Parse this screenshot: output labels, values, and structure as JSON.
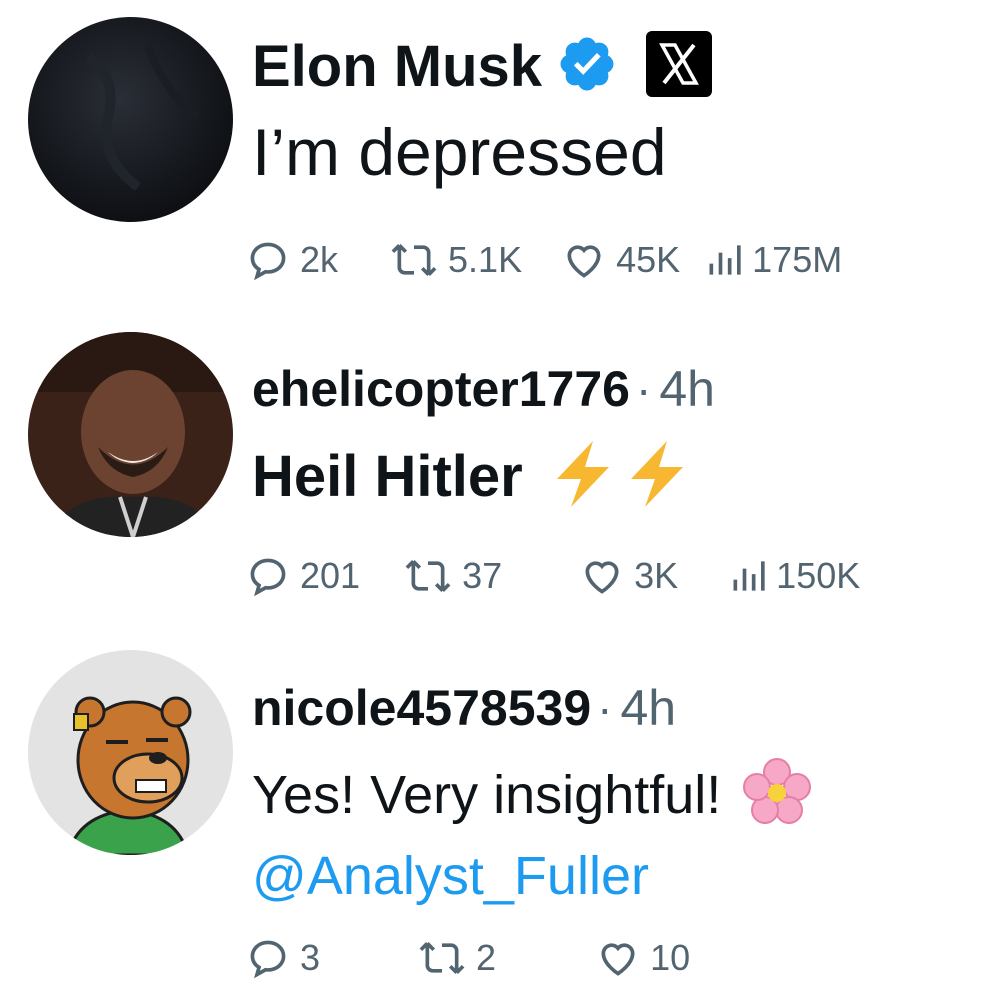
{
  "posts": [
    {
      "name": "Elon Musk",
      "verified": true,
      "affiliate_badge": "x-logo",
      "text": "I’m depressed",
      "metrics": {
        "replies": "2k",
        "reposts": "5.1K",
        "likes": "45K",
        "views": "175M"
      }
    },
    {
      "name": "ehelicopter1776",
      "time": "4h",
      "separator": "·",
      "text": "Heil Hitler",
      "emoji": "⚡⚡",
      "metrics": {
        "replies": "201",
        "reposts": "37",
        "likes": "3K",
        "views": "150K"
      }
    },
    {
      "name": "nicole4578539",
      "time": "4h",
      "separator": "·",
      "text": "Yes! Very insightful!",
      "emoji": "🌸",
      "mention": "@Analyst_Fuller",
      "metrics": {
        "replies": "3",
        "reposts": "2",
        "likes": "10"
      }
    }
  ],
  "colors": {
    "text": "#0f1419",
    "secondary": "#536471",
    "link": "#1d9bf0",
    "verified": "#1d9bf0",
    "lightning": "#f7b731",
    "flower": "#f7a8c6"
  },
  "icons": [
    "reply-icon",
    "repost-icon",
    "like-icon",
    "views-icon",
    "verified-badge-icon",
    "x-logo-icon",
    "lightning-icon",
    "cherry-blossom-icon"
  ]
}
